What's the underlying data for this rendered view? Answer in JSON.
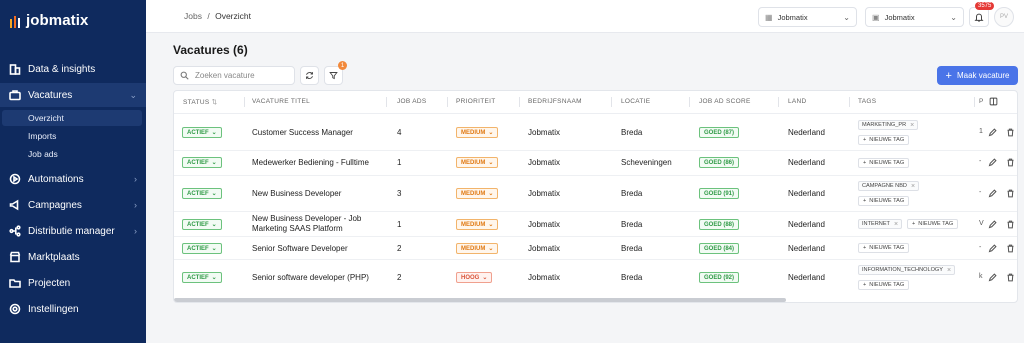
{
  "brand": {
    "logo_text": "jobmatix"
  },
  "sidebar": {
    "items": [
      {
        "label": "Data & insights",
        "icon": "building-icon"
      },
      {
        "label": "Vacatures",
        "icon": "briefcase-icon"
      },
      {
        "label": "Automations",
        "icon": "play-circle-icon"
      },
      {
        "label": "Campagnes",
        "icon": "megaphone-icon"
      },
      {
        "label": "Distributie manager",
        "icon": "distribution-icon"
      },
      {
        "label": "Marktplaats",
        "icon": "store-icon"
      },
      {
        "label": "Projecten",
        "icon": "folder-icon"
      },
      {
        "label": "Instellingen",
        "icon": "settings-icon"
      }
    ],
    "subitems": [
      {
        "label": "Overzicht"
      },
      {
        "label": "Imports"
      },
      {
        "label": "Job ads"
      }
    ]
  },
  "topbar": {
    "breadcrumb_root": "Jobs",
    "breadcrumb_sep": "/",
    "breadcrumb_current": "Overzicht",
    "select1": "Jobmatix",
    "select2": "Jobmatix",
    "notification_count": "3575",
    "avatar_initials": "PV"
  },
  "page": {
    "title": "Vacatures (6)",
    "search_placeholder": "Zoeken vacature",
    "filter_count": "1",
    "create_button": "Maak vacature"
  },
  "table": {
    "headers": [
      "STATUS",
      "VACATURE TITEL",
      "JOB ADS",
      "PRIORITEIT",
      "BEDRIJFSNAAM",
      "LOCATIE",
      "JOB AD SCORE",
      "LAND",
      "TAGS"
    ],
    "new_tag_label": "NIEUWE TAG",
    "rows": [
      {
        "status": "ACTIEF",
        "title": "Customer Success Manager",
        "title2": "",
        "job_ads": "4",
        "priority": "MEDIUM",
        "company": "Jobmatix",
        "location": "Breda",
        "score": "GOED (87)",
        "country": "Nederland",
        "tags": [
          "MARKETING_PR"
        ],
        "extra": "1"
      },
      {
        "status": "ACTIEF",
        "title": "Medewerker Bediening - Fulltime",
        "title2": "",
        "job_ads": "1",
        "priority": "MEDIUM",
        "company": "Jobmatix",
        "location": "Scheveningen",
        "score": "GOED (86)",
        "country": "Nederland",
        "tags": [],
        "extra": "-"
      },
      {
        "status": "ACTIEF",
        "title": "New Business Developer",
        "title2": "",
        "job_ads": "3",
        "priority": "MEDIUM",
        "company": "Jobmatix",
        "location": "Breda",
        "score": "GOED (91)",
        "country": "Nederland",
        "tags": [
          "CAMPAGNE NBD"
        ],
        "extra": "-"
      },
      {
        "status": "ACTIEF",
        "title": "New Business Developer - Job",
        "title2": "Marketing SAAS Platform",
        "job_ads": "1",
        "priority": "MEDIUM",
        "company": "Jobmatix",
        "location": "Breda",
        "score": "GOED (88)",
        "country": "Nederland",
        "tags": [
          "INTERNET"
        ],
        "extra": "V"
      },
      {
        "status": "ACTIEF",
        "title": "Senior Software Developer",
        "title2": "",
        "job_ads": "2",
        "priority": "MEDIUM",
        "company": "Jobmatix",
        "location": "Breda",
        "score": "GOED (84)",
        "country": "Nederland",
        "tags": [],
        "extra": "-"
      },
      {
        "status": "ACTIEF",
        "title": "Senior software developer (PHP)",
        "title2": "",
        "job_ads": "2",
        "priority": "HOOG",
        "company": "Jobmatix",
        "location": "Breda",
        "score": "GOED (92)",
        "country": "Nederland",
        "tags": [
          "INFORMATION_TECHNOLOGY"
        ],
        "extra": "k"
      }
    ]
  }
}
